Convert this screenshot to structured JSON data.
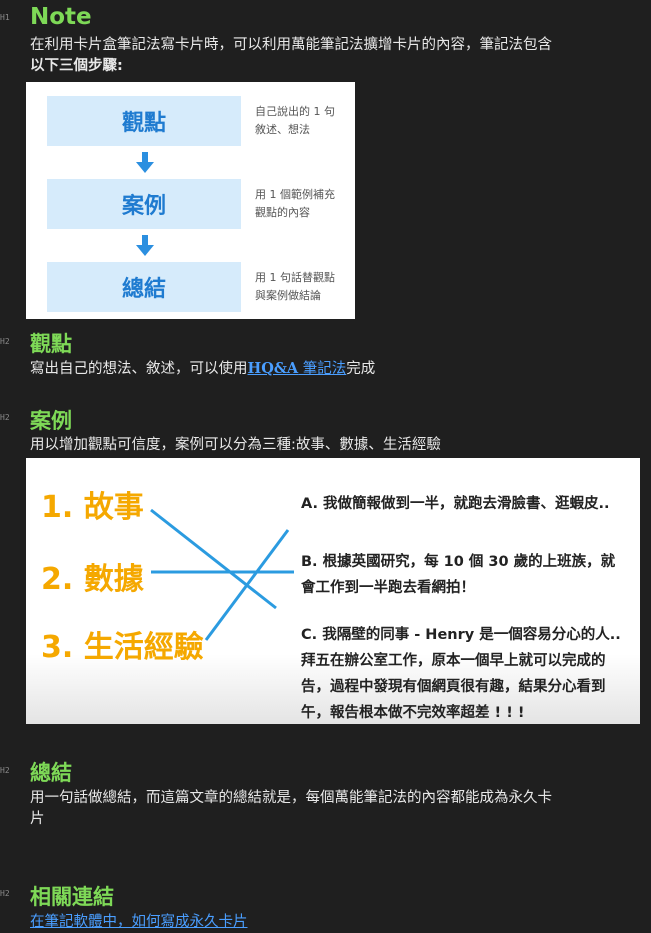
{
  "gutter": [
    "H1",
    "H2",
    "H2",
    "H2",
    "H2"
  ],
  "note": {
    "title": "Note",
    "intro_line1": "在利用卡片盒筆記法寫卡片時，可以利用萬能筆記法擴增卡片的內容，筆記法包含",
    "intro_line2": "以下三個步驟:"
  },
  "steps_image": {
    "steps": [
      {
        "label": "觀點",
        "note_line1": "自己說出的 1 句",
        "note_line2": "敘述、想法"
      },
      {
        "label": "案例",
        "note_line1": "用 1 個範例補充",
        "note_line2": "觀點的內容"
      },
      {
        "label": "總結",
        "note_line1": "用 1 句話替觀點",
        "note_line2": "與案例做結論"
      }
    ]
  },
  "viewpoint": {
    "title": "觀點",
    "text_before": "寫出自己的想法、敘述，可以使用",
    "link_bold": "HQ&A",
    "link_text": " 筆記法",
    "text_after": "完成"
  },
  "cases": {
    "title": "案例",
    "text": "用以增加觀點可信度，案例可以分為三種:故事、數據、生活經驗"
  },
  "cases_image": {
    "categories": [
      "1. 故事",
      "2. 數據",
      "3. 生活經驗"
    ],
    "story_a": "A. 我做簡報做到一半，就跑去滑臉書、逛蝦皮..",
    "story_b_line1": "B. 根據英國研究，每 10 個 30 歲的上班族，就",
    "story_b_line2": "會工作到一半跑去看網拍！",
    "story_c_line1": "C. 我隔壁的同事 - Henry 是一個容易分心的人..",
    "story_c_line2": "拜五在辦公室工作，原本一個早上就可以完成的",
    "story_c_line3": "告，過程中發現有個網頁很有趣，結果分心看到",
    "story_c_line4": "午，報告根本做不完效率超差 ! ! !",
    "colors": {
      "category": "#f5a800",
      "line": "#2b9be0",
      "box": "#d6ebfb",
      "box_text": "#1f7bd0"
    }
  },
  "summary": {
    "title": "總結",
    "text_line1": "用一句話做總結，而這篇文章的總結就是，每個萬能筆記法的內容都能成為永久卡",
    "text_line2": "片"
  },
  "related": {
    "title": "相關連結",
    "link": "在筆記軟體中，如何寫成永久卡片"
  }
}
